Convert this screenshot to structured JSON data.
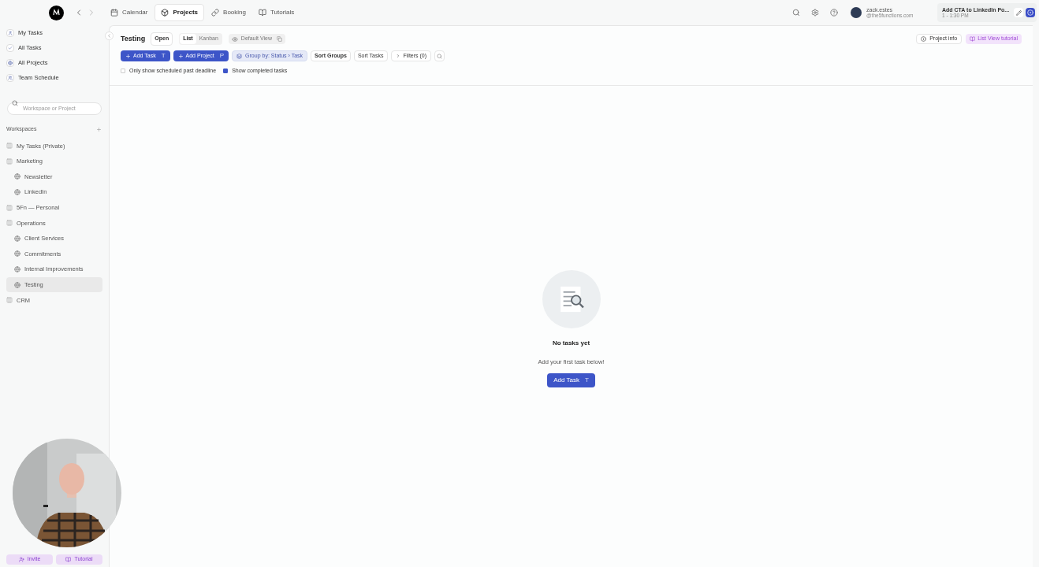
{
  "nav": {
    "tabs": [
      {
        "label": "Calendar",
        "selected": false
      },
      {
        "label": "Projects",
        "selected": true
      },
      {
        "label": "Booking",
        "selected": false
      },
      {
        "label": "Tutorials",
        "selected": false
      }
    ],
    "user": {
      "name": "zack.estes",
      "email": "@the5functions.com"
    },
    "event": {
      "title": "Add CTA to LinkedIn Po...",
      "time": "1 - 1:30 PM"
    }
  },
  "sidebar": {
    "items": [
      {
        "label": "My Tasks"
      },
      {
        "label": "All Tasks"
      },
      {
        "label": "All Projects"
      },
      {
        "label": "Team Schedule"
      }
    ],
    "search": {
      "placeholder": "Workspace or Project"
    },
    "workspaces_heading": "Workspaces",
    "workspaces": [
      {
        "label": "My Tasks (Private)",
        "selected": false
      },
      {
        "label": "Marketing",
        "selected": false,
        "children": [
          {
            "label": "Newsletter",
            "selected": false
          },
          {
            "label": "LinkedIn",
            "selected": false
          }
        ]
      },
      {
        "label": "5Fn — Personal",
        "selected": false
      },
      {
        "label": "Operations",
        "selected": false,
        "children": [
          {
            "label": "Client Services",
            "selected": false
          },
          {
            "label": "Commitments",
            "selected": false
          },
          {
            "label": "Internal Improvements",
            "selected": false
          },
          {
            "label": "Testing",
            "selected": true
          }
        ]
      },
      {
        "label": "CRM",
        "selected": false
      }
    ],
    "footer": {
      "invite": "Invite",
      "tutorial": "Tutorial"
    }
  },
  "project": {
    "title": "Testing",
    "status": "Open",
    "views": [
      {
        "label": "List",
        "selected": true
      },
      {
        "label": "Kanban",
        "selected": false
      }
    ],
    "view_name": "Default View",
    "info": "Project info",
    "tutorial": "List View tutorial",
    "toolbar": {
      "add_task": {
        "label": "Add Task",
        "shortcut": "T"
      },
      "add_project": {
        "label": "Add Project",
        "shortcut": "P"
      },
      "group_by": "Group by: Status › Task",
      "sort_groups": "Sort Groups",
      "sort_tasks": "Sort Tasks",
      "filters": "Filters (0)"
    },
    "options": [
      {
        "label": "Only show scheduled past deadline",
        "checked": false
      },
      {
        "label": "Show completed tasks",
        "checked": true
      }
    ]
  },
  "empty": {
    "title": "No tasks yet",
    "subtitle": "Add your first task below!",
    "button": {
      "label": "Add Task",
      "shortcut": "T"
    }
  }
}
